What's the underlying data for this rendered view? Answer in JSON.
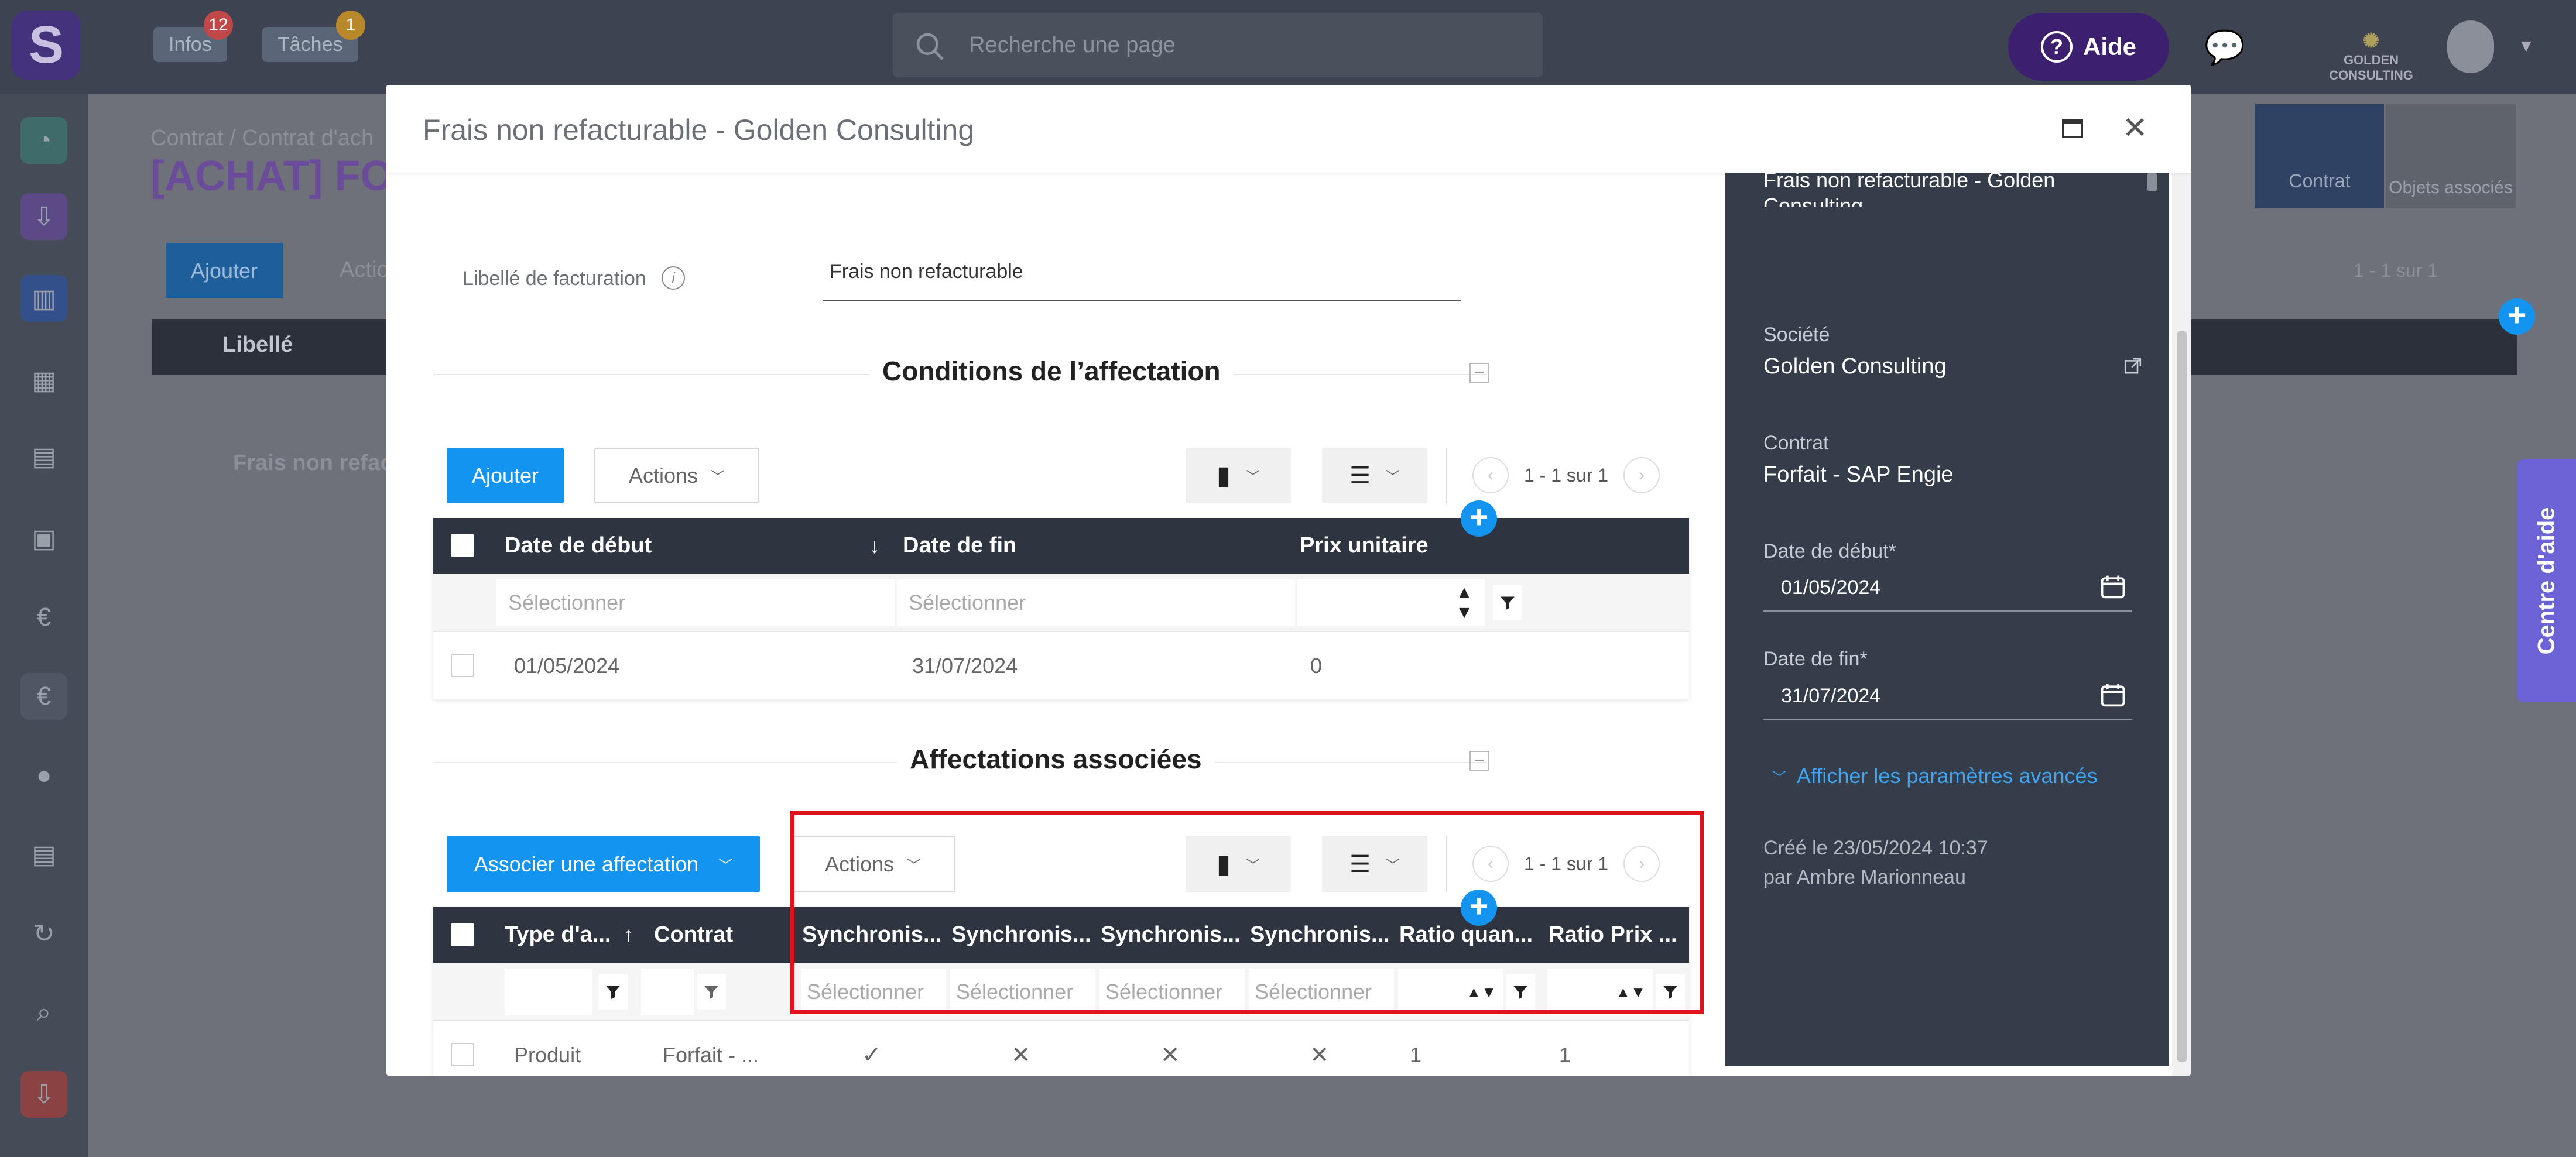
{
  "topbar": {
    "logo_letter": "S",
    "infos_label": "Infos",
    "infos_count": "12",
    "taches_label": "Tâches",
    "taches_count": "1",
    "search_placeholder": "Recherche une page",
    "aide_label": "Aide",
    "company_name": "GOLDEN CONSULTING",
    "colors": {
      "aide_bg": "#3c1f6e",
      "infos_badge": "#e04a4a",
      "taches_badge": "#d89a2b"
    }
  },
  "background_page": {
    "breadcrumb": "Contrat  /  Contrat d'ach",
    "title": "[ACHAT] FO",
    "ajouter": "Ajouter",
    "actions": "Actio",
    "col_libelle": "Libellé",
    "row_text": "Frais non refact",
    "pager": "1 - 1 sur 1",
    "right_tabs": [
      "Contrat",
      "Objets associés"
    ]
  },
  "help_center": "Centre d'aide",
  "modal": {
    "title": "Frais non refacturable - Golden Consulting",
    "libelle_facturation_label": "Libellé de facturation",
    "libelle_facturation_value": "Frais non refacturable",
    "section_conditions": {
      "title": "Conditions de l’affectation",
      "ajouter": "Ajouter",
      "actions": "Actions",
      "pager": "1 - 1 sur 1",
      "columns": [
        "Date de début",
        "Date de fin",
        "Prix unitaire"
      ],
      "sort_indicator": "↓",
      "filter_placeholder": "Sélectionner",
      "rows": [
        {
          "debut": "01/05/2024",
          "fin": "31/07/2024",
          "prix": "0"
        }
      ]
    },
    "section_affectations": {
      "title": "Affectations associées",
      "associer": "Associer une affectation",
      "actions": "Actions",
      "pager": "1 - 1 sur 1",
      "columns": [
        "Type d'a...",
        "Contrat",
        "Synchronis...",
        "Synchronis...",
        "Synchronis...",
        "Synchronis...",
        "Ratio quan...",
        "Ratio Prix ..."
      ],
      "sort_indicator": "↑",
      "filter_placeholder": "Sélectionner",
      "rows": [
        {
          "type": "Produit",
          "contrat": "Forfait - ...",
          "sync1": "✓",
          "sync2": "✕",
          "sync3": "✕",
          "sync4": "✕",
          "ratio_quan": "1",
          "ratio_prix": "1"
        }
      ]
    }
  },
  "right_panel": {
    "top_text_1": "Frais non refacturable - Golden",
    "top_text_2": "Consulting",
    "societe_label": "Société",
    "societe_value": "Golden Consulting",
    "contrat_label": "Contrat",
    "contrat_value": "Forfait - SAP Engie",
    "date_debut_label": "Date de début*",
    "date_debut_value": "01/05/2024",
    "date_fin_label": "Date de fin*",
    "date_fin_value": "31/07/2024",
    "advanced_link": "Afficher les paramètres avancés",
    "created_line": "Créé le   23/05/2024 10:37",
    "created_by": "par Ambre Marionneau",
    "colors": {
      "panel_bg": "#363d4a",
      "link": "#3fa6f5"
    }
  }
}
